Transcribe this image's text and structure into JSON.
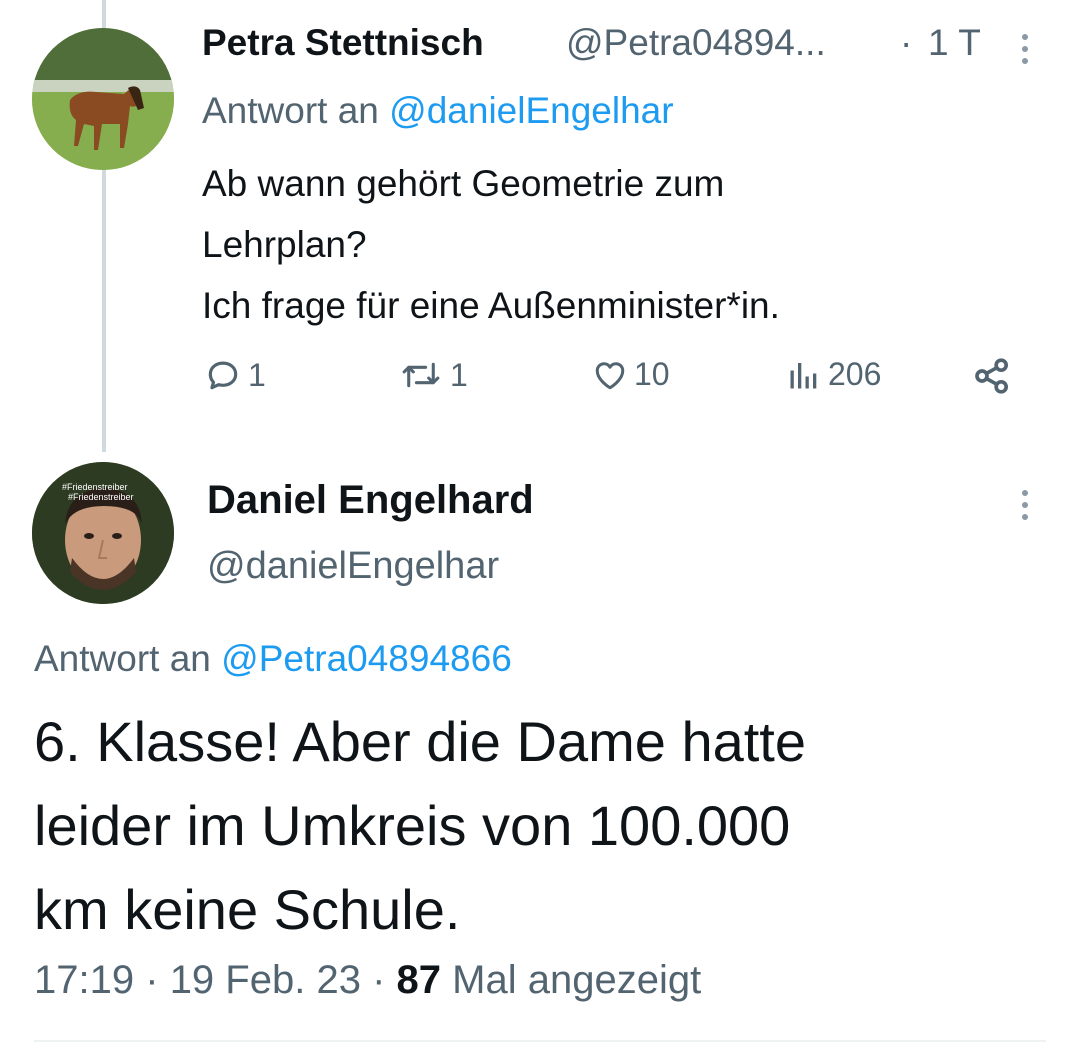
{
  "reply_tweet": {
    "author_name": "Petra Stettnisch",
    "author_handle": "@Petra04894...",
    "separator": "·",
    "age": "1 T",
    "reply_prefix": "Antwort an",
    "reply_mention": "@danielEngelhar",
    "body_lines": [
      "Ab wann gehört Geometrie zum",
      "Lehrplan?",
      "Ich frage für eine Außenminister*in."
    ],
    "actions": {
      "reply_count": "1",
      "retweet_count": "1",
      "like_count": "10",
      "view_count": "206"
    },
    "icons": [
      "reply-icon",
      "retweet-icon",
      "like-icon",
      "views-icon",
      "share-icon",
      "more-icon"
    ]
  },
  "main_tweet": {
    "author_name": "Daniel Engelhard",
    "author_handle": "@danielEngelhar",
    "reply_prefix": "Antwort an",
    "reply_mention": "@Petra04894866",
    "body_lines": [
      "6. Klasse! Aber die Dame hatte",
      "leider im Umkreis von 100.000",
      "km keine Schule."
    ],
    "time": "17:19",
    "date": "19 Feb. 23",
    "separator": "·",
    "view_count": "87",
    "view_label": "Mal angezeigt",
    "avatar_overlay_text": [
      "#Friedenstreiber",
      "#Friedenstreiber"
    ]
  },
  "colors": {
    "text": "#0f1419",
    "secondary": "#536471",
    "link": "#1d9bf0",
    "thread_line": "#cfd9de"
  }
}
